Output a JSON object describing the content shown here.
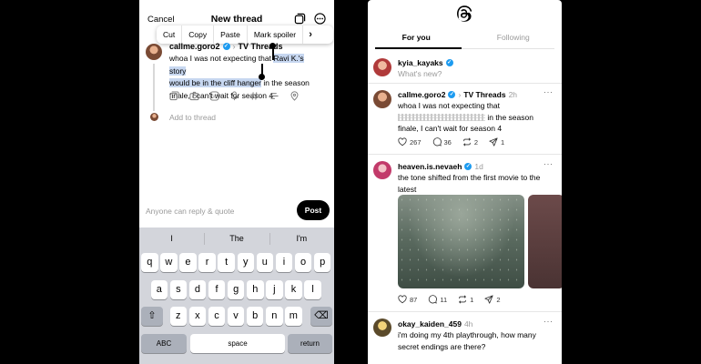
{
  "composer": {
    "cancel": "Cancel",
    "title": "New thread",
    "context_menu": [
      "Cut",
      "Copy",
      "Paste",
      "Mark spoiler"
    ],
    "username": "callme.goro2",
    "topic": "TV Threads",
    "text_before": "whoa I was not expecting that ",
    "text_selected_1": "Ravi K.'s story",
    "text_selected_2": "would be in the cliff hanger",
    "text_after": " in the season finale, I can't wait for season 4",
    "add_to_thread": "Add to thread",
    "reply_setting": "Anyone can reply & quote",
    "post": "Post"
  },
  "keyboard": {
    "suggestions": [
      "I",
      "The",
      "I'm"
    ],
    "row1": [
      "q",
      "w",
      "e",
      "r",
      "t",
      "y",
      "u",
      "i",
      "o",
      "p"
    ],
    "row2": [
      "a",
      "s",
      "d",
      "f",
      "g",
      "h",
      "j",
      "k",
      "l"
    ],
    "row3": [
      "z",
      "x",
      "c",
      "v",
      "b",
      "n",
      "m"
    ],
    "abc": "ABC",
    "space": "space",
    "return": "return"
  },
  "feed": {
    "tabs": [
      "For you",
      "Following"
    ],
    "composer_user": "kyia_kayaks",
    "composer_placeholder": "What's new?",
    "posts": [
      {
        "user": "callme.goro2",
        "topic": "TV Threads",
        "time": "2h",
        "text_start": "whoa I was not expecting that",
        "text_end": "in the season finale, I can't wait for season 4",
        "likes": "267",
        "replies": "36",
        "reposts": "2",
        "shares": "1"
      },
      {
        "user": "heaven.is.nevaeh",
        "time": "1d",
        "text": "the tone shifted from the first movie to the latest",
        "likes": "87",
        "replies": "11",
        "reposts": "1",
        "shares": "2"
      },
      {
        "user": "okay_kaiden_459",
        "time": "4h",
        "text": "i'm doing my 4th playthrough, how many secret endings are there?"
      }
    ]
  }
}
